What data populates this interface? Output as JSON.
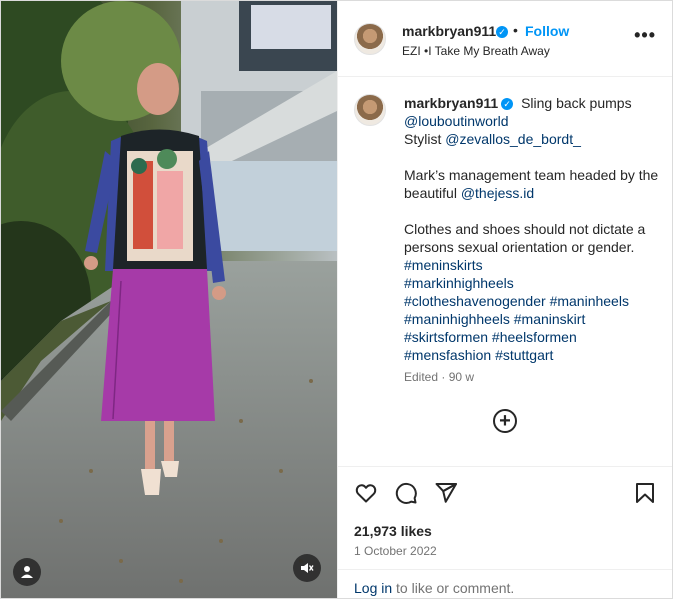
{
  "post": {
    "username": "markbryan911",
    "verified_icon": "verified-badge-icon",
    "separator": "•",
    "follow_label": "Follow",
    "audio_label": "EZI •I Take My Breath Away",
    "more_options_label": "•••"
  },
  "caption": {
    "username": "markbryan911",
    "line1_text": " Sling back pumps",
    "brand_tag": "@louboutinworld",
    "stylist_prefix": "Stylist ",
    "stylist_tag": "@zevallos_de_bordt_",
    "mgmt_text": "Mark’s management team headed by the beautiful ",
    "mgmt_tag": "@thejess.id",
    "body_text": "Clothes and shoes should not dictate a persons sexual orientation or gender. ",
    "hashtags": [
      "#meninskirts",
      "#markinhighheels",
      "#clotheshavenogender",
      "#maninheels",
      "#maninhighheels",
      "#maninskirt",
      "#skirtsformen",
      "#heelsformen",
      "#mensfashion",
      "#stuttgart"
    ],
    "edited_label": "Edited",
    "edited_sep": " · ",
    "age": "90 w"
  },
  "actions": {
    "like_icon": "heart-icon",
    "comment_icon": "comment-icon",
    "share_icon": "share-icon",
    "save_icon": "bookmark-icon",
    "add_comment_icon": "plus-circle-icon"
  },
  "stats": {
    "likes": "21,973 likes",
    "date": "1 October 2022"
  },
  "login_prompt": {
    "link_label": "Log in",
    "rest": " to like or comment."
  },
  "colors": {
    "link": "#00376b",
    "accent": "#0095f6",
    "skirt": "#a63aa8",
    "secondary_text": "#737373"
  }
}
